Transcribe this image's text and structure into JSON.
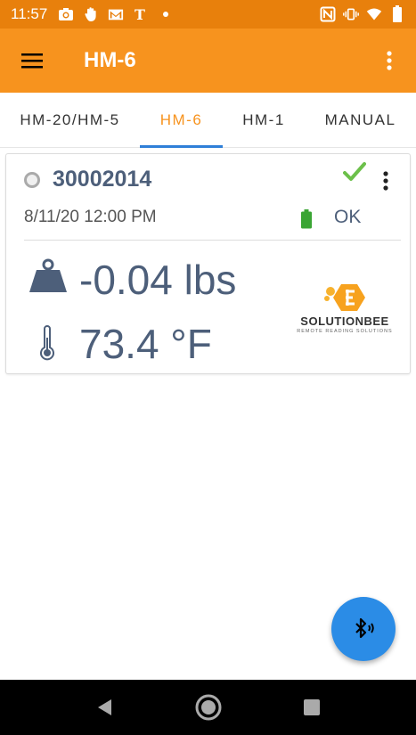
{
  "statusbar": {
    "time": "11:57",
    "left_icons": [
      "camera-icon",
      "hand-icon",
      "gmail-icon",
      "nytimes-icon",
      "notification-dot-icon"
    ],
    "right_icons": [
      "nfc-icon",
      "vibrate-icon",
      "wifi-icon",
      "battery-icon"
    ]
  },
  "appbar": {
    "title": "HM-6",
    "menu_icon": "hamburger-menu-icon",
    "more_icon": "more-vertical-icon",
    "color": "#f7931e"
  },
  "tabs": [
    {
      "label": "HM-20/HM-5",
      "active": false
    },
    {
      "label": "HM-6",
      "active": true
    },
    {
      "label": "HM-1",
      "active": false
    },
    {
      "label": "MANUAL",
      "active": false
    }
  ],
  "card": {
    "device_id": "30002014",
    "datetime": "8/11/20 12:00 PM",
    "battery_status": "OK",
    "weight": "-0.04 lbs",
    "temperature": "73.4 °F",
    "logo": {
      "name": "SOLUTIONBEE",
      "tagline": "REMOTE READING SOLUTIONS"
    },
    "colors": {
      "check": "#6cc04a",
      "battery": "#3aa534",
      "value_text": "#4d5f7a"
    }
  },
  "fab": {
    "icon": "bluetooth-audio-icon",
    "color": "#2b8ce6"
  },
  "navbar": {
    "icons": [
      "back-icon",
      "home-icon",
      "recents-icon"
    ]
  }
}
